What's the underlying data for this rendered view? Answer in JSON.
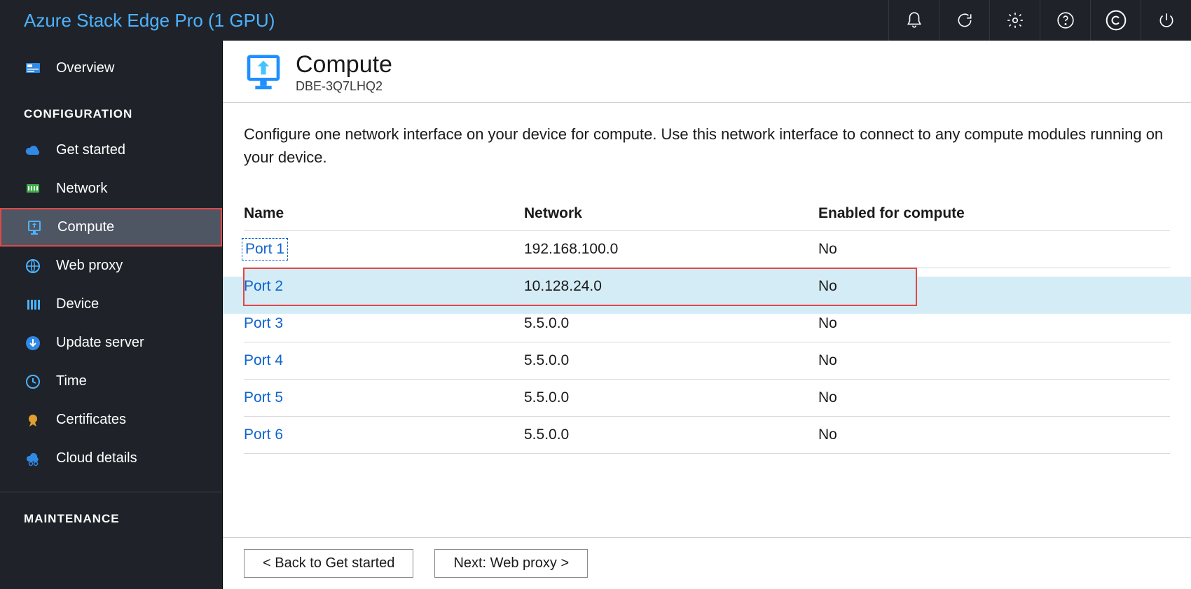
{
  "topbar": {
    "title": "Azure Stack Edge Pro (1 GPU)"
  },
  "sidebar": {
    "overview": "Overview",
    "section_config": "CONFIGURATION",
    "items": [
      {
        "label": "Get started"
      },
      {
        "label": "Network"
      },
      {
        "label": "Compute"
      },
      {
        "label": "Web proxy"
      },
      {
        "label": "Device"
      },
      {
        "label": "Update server"
      },
      {
        "label": "Time"
      },
      {
        "label": "Certificates"
      },
      {
        "label": "Cloud details"
      }
    ],
    "section_maint": "MAINTENANCE"
  },
  "page": {
    "title": "Compute",
    "device_id": "DBE-3Q7LHQ2",
    "description": "Configure one network interface on your device for compute. Use this network interface to connect to any compute modules running on your device."
  },
  "table": {
    "headers": {
      "name": "Name",
      "network": "Network",
      "enabled": "Enabled for compute"
    },
    "rows": [
      {
        "name": "Port 1",
        "network": "192.168.100.0",
        "enabled": "No"
      },
      {
        "name": "Port 2",
        "network": "10.128.24.0",
        "enabled": "No"
      },
      {
        "name": "Port 3",
        "network": "5.5.0.0",
        "enabled": "No"
      },
      {
        "name": "Port 4",
        "network": "5.5.0.0",
        "enabled": "No"
      },
      {
        "name": "Port 5",
        "network": "5.5.0.0",
        "enabled": "No"
      },
      {
        "name": "Port 6",
        "network": "5.5.0.0",
        "enabled": "No"
      }
    ]
  },
  "footer": {
    "back": "<  Back to Get started",
    "next": "Next: Web proxy  >"
  }
}
